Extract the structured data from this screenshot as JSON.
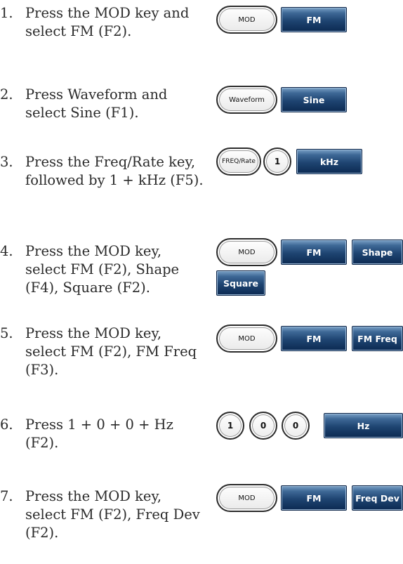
{
  "steps": [
    {
      "num": "1.",
      "text": "Press the MOD key and select FM (F2).",
      "keys": [
        "MOD",
        "FM"
      ]
    },
    {
      "num": "2.",
      "text": "Press Waveform and select Sine (F1).",
      "keys": [
        "Waveform",
        "Sine"
      ]
    },
    {
      "num": "3.",
      "text": "Press the Freq/Rate key, followed by 1 + kHz (F5).",
      "keys": [
        "FREQ/Rate",
        "1",
        "kHz"
      ]
    },
    {
      "num": "4.",
      "text": "Press the MOD key, select FM (F2), Shape (F4), Square (F2).",
      "keys": [
        "MOD",
        "FM",
        "Shape",
        "Square"
      ]
    },
    {
      "num": "5.",
      "text": "Press the MOD key, select FM (F2), FM Freq (F3).",
      "keys": [
        "MOD",
        "FM",
        "FM Freq"
      ]
    },
    {
      "num": "6.",
      "text": "Press 1 + 0 + 0 + Hz (F2).",
      "keys": [
        "1",
        "0",
        "0",
        "Hz"
      ]
    },
    {
      "num": "7.",
      "text": "Press the MOD key, select FM (F2), Freq Dev (F2).",
      "keys": [
        "MOD",
        "FM",
        "Freq Dev"
      ]
    }
  ]
}
